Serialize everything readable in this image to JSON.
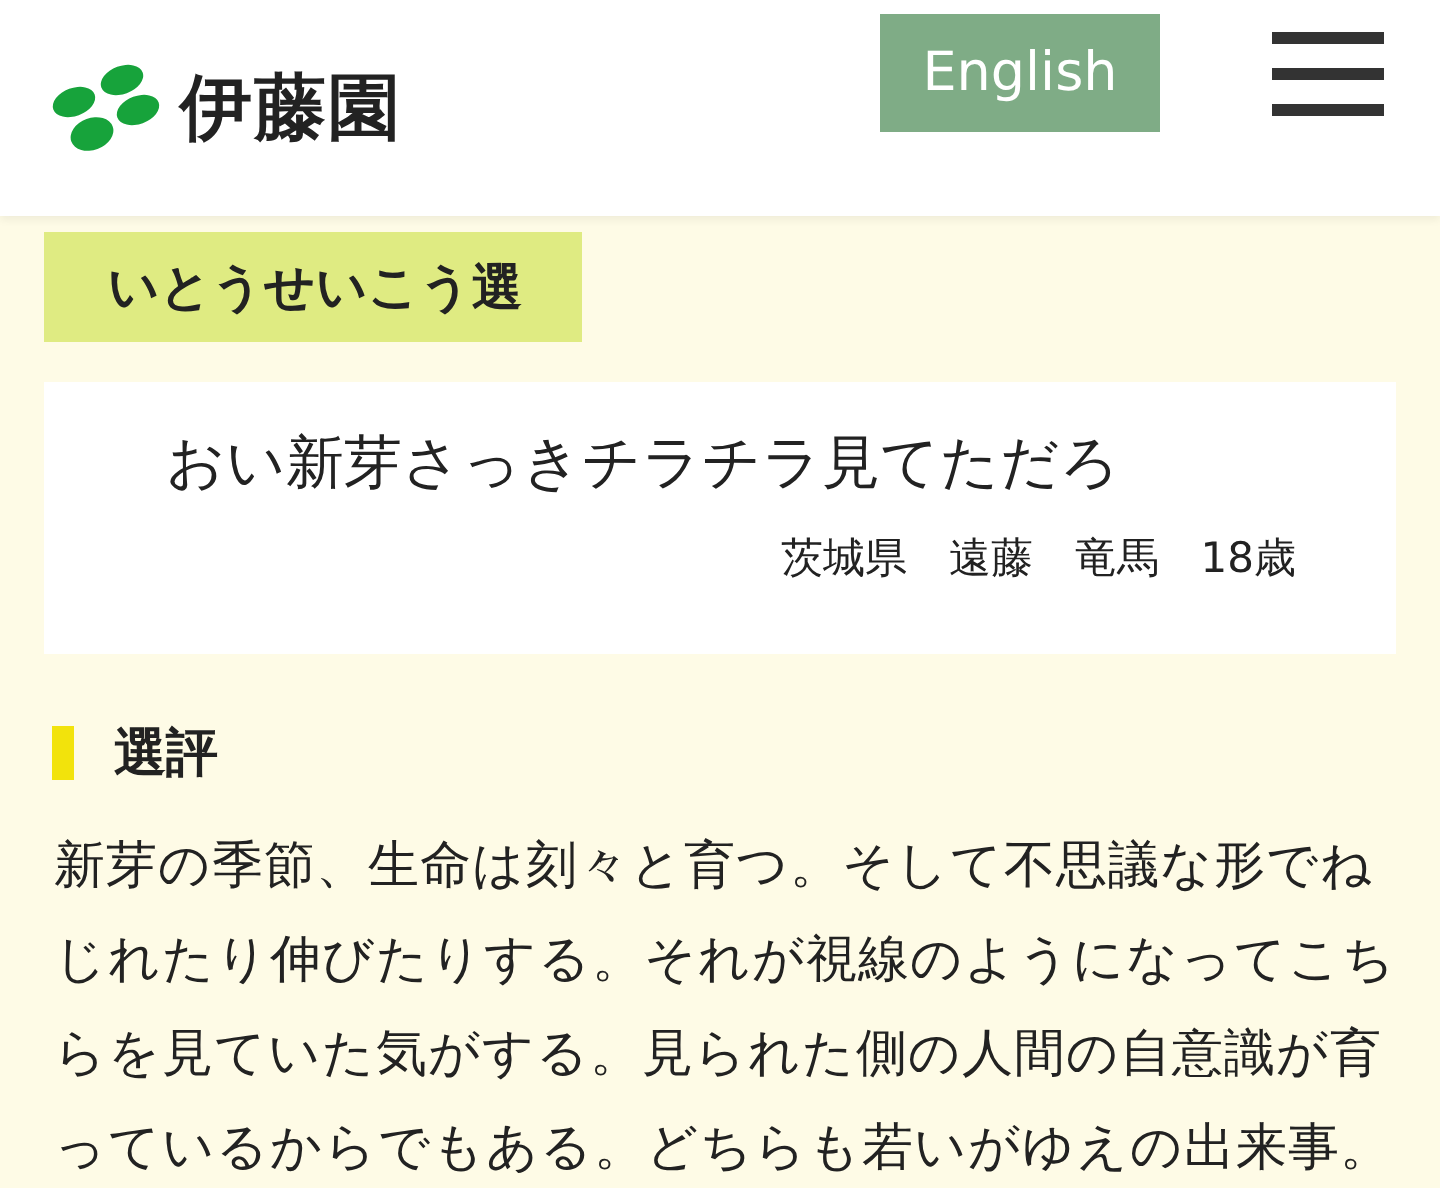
{
  "header": {
    "logo_text": "伊藤園",
    "language_button": "English"
  },
  "category_tag": "いとうせいこう選",
  "poem": {
    "text": "おい新芽さっきチラチラ見てただろ",
    "author": "茨城県　遠藤　竜馬　18歳"
  },
  "review": {
    "heading": "選評",
    "body": "新芽の季節、生命は刻々と育つ。そして不思議な形でねじれたり伸びたりする。それが視線のようになってこちらを見ていた気がする。見られた側の人間の自意識が育っているからでもある。どちらも若いがゆえの出来事。"
  }
}
